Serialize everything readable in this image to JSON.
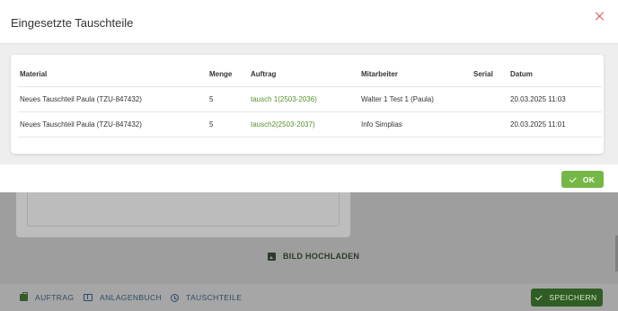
{
  "modal": {
    "title": "Eingesetzte Tauschteile",
    "close_icon": "close-icon",
    "table": {
      "headers": {
        "material": "Material",
        "menge": "Menge",
        "auftrag": "Auftrag",
        "mitarbeiter": "Mitarbeiter",
        "serial": "Serial",
        "datum": "Datum"
      },
      "rows": [
        {
          "material": "Neues Tauschteil Paula (TZU-847432)",
          "menge": "5",
          "auftrag": "tausch 1(2503-2036)",
          "mitarbeiter": "Walter 1 Test 1 (Paula)",
          "serial": "",
          "datum": "20.03.2025 11:03"
        },
        {
          "material": "Neues Tauschteil Paula (TZU-847432)",
          "menge": "5",
          "auftrag": "tausch2(2503-2037)",
          "mitarbeiter": "Info Simplias",
          "serial": "",
          "datum": "20.03.2025 11:01"
        }
      ]
    },
    "ok_label": "OK"
  },
  "background": {
    "upload_label": "BILD HOCHLADEN",
    "bottom_nav": {
      "auftrag": "AUFTRAG",
      "anlagenbuch": "ANLAGENBUCH",
      "tauschteile": "TAUSCHTEILE"
    },
    "save_label": "SPEICHERN"
  },
  "colors": {
    "accent_green": "#76b847",
    "link_green": "#5a8f2e",
    "close_red": "#d9534f",
    "nav_blue": "#2f4a66"
  }
}
